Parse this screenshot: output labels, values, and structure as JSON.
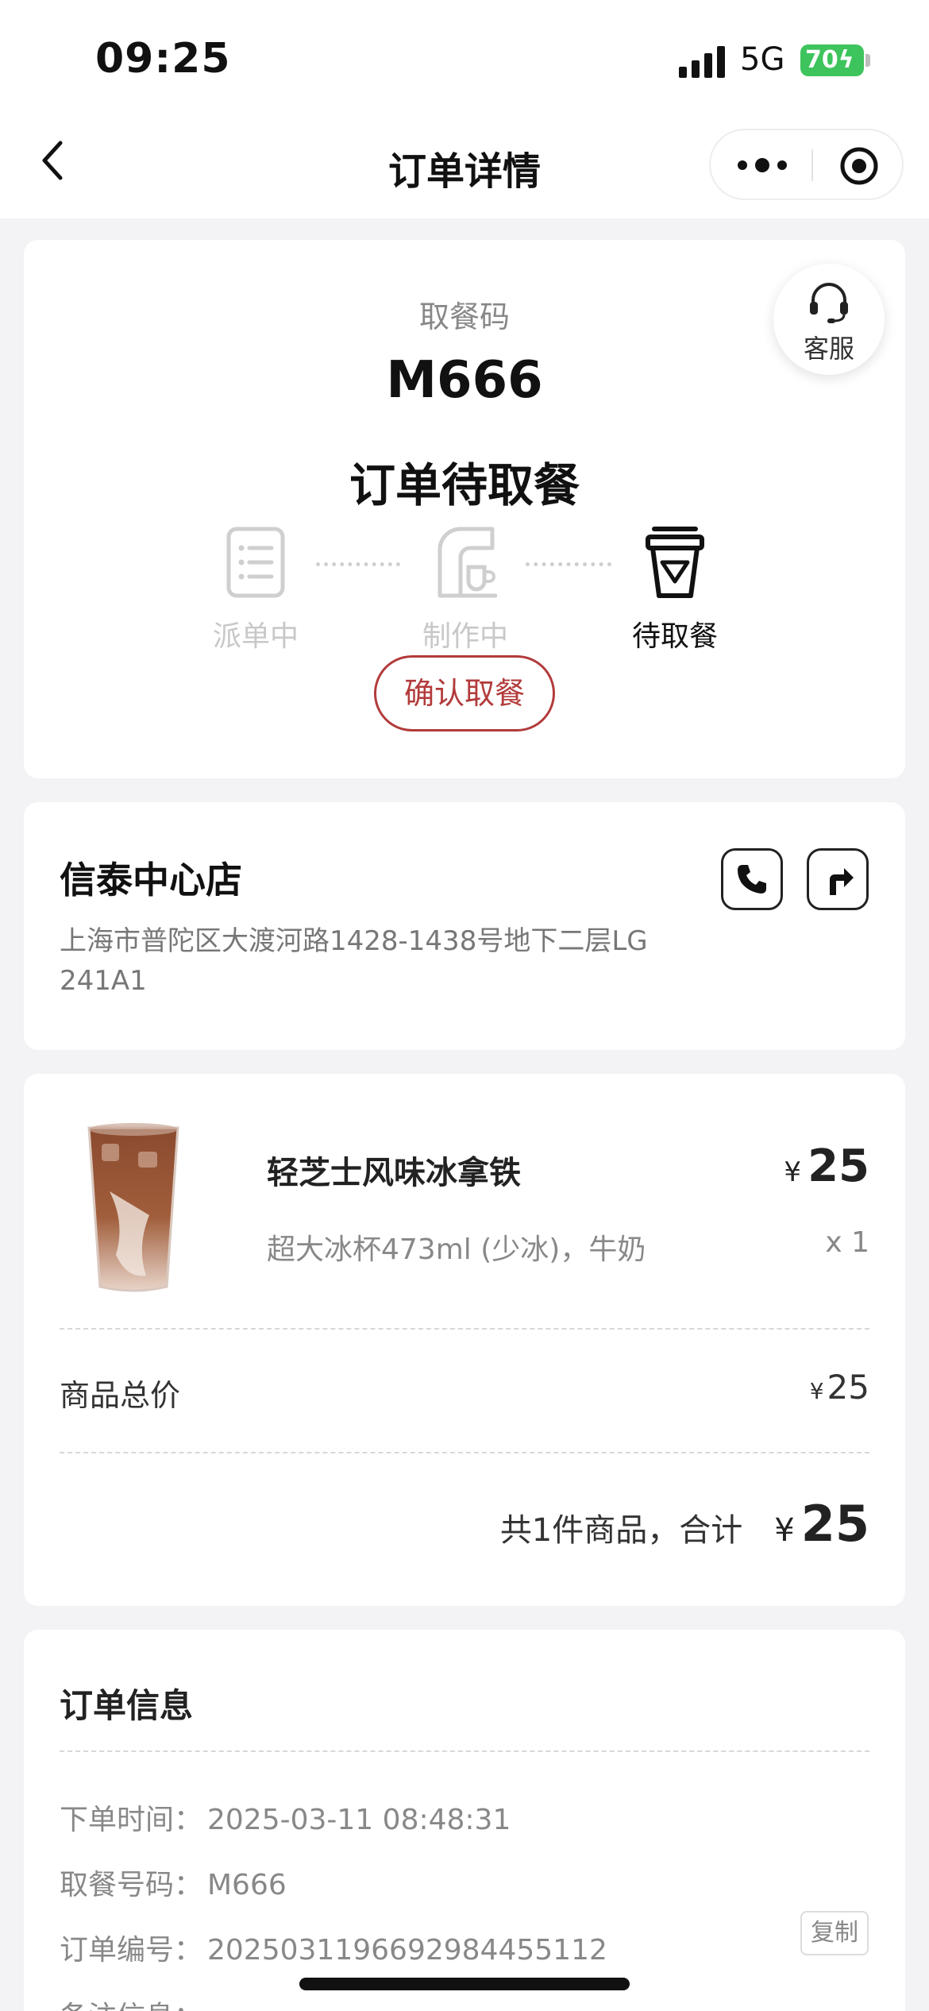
{
  "status_bar": {
    "time": "09:25",
    "network": "5G",
    "battery": "70"
  },
  "nav": {
    "title": "订单详情"
  },
  "pickup": {
    "label": "取餐码",
    "code": "M666",
    "status_title": "订单待取餐",
    "service_label": "客服",
    "steps": [
      {
        "label": "派单中",
        "icon": "dispatch-icon",
        "active": false
      },
      {
        "label": "制作中",
        "icon": "coffee-machine-icon",
        "active": false
      },
      {
        "label": "待取餐",
        "icon": "cup-icon",
        "active": true
      }
    ],
    "confirm_label": "确认取餐"
  },
  "store": {
    "name": "信泰中心店",
    "address": "上海市普陀区大渡河路1428-1438号地下二层LG 241A1",
    "phone_icon": "phone-icon",
    "navigate_icon": "directions-icon"
  },
  "order": {
    "items": [
      {
        "name": "轻芝士风味冰拿铁",
        "currency": "¥",
        "price": "25",
        "spec": "超大冰杯473ml (少冰)，牛奶",
        "qty": "x 1"
      }
    ],
    "subtotal_label": "商品总价",
    "subtotal_currency": "¥",
    "subtotal_value": "25",
    "total_text": "共1件商品，合计",
    "total_currency": "¥",
    "total_value": "25"
  },
  "info": {
    "title": "订单信息",
    "rows": [
      {
        "key": "下单时间：",
        "value": "2025-03-11 08:48:31"
      },
      {
        "key": "取餐号码：",
        "value": "M666"
      },
      {
        "key": "订单编号：",
        "value": "2025031196692984455112"
      },
      {
        "key": "备注信息：",
        "value": ""
      }
    ],
    "copy_label": "复制"
  },
  "colors": {
    "accent": "#b23b3b",
    "battery": "#3dc45c",
    "background": "#f3f3f5"
  }
}
